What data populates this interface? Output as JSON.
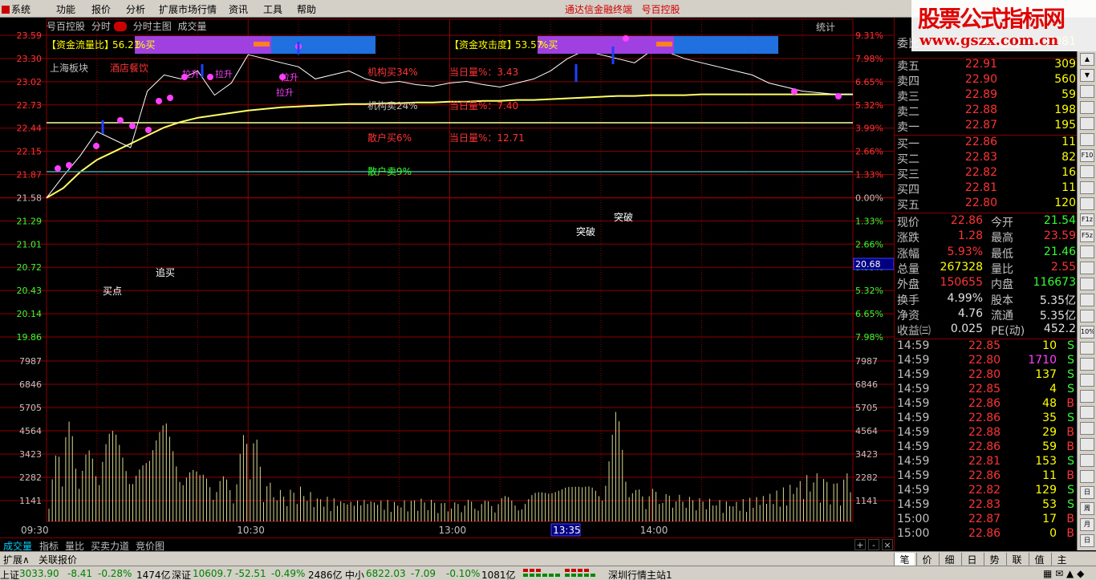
{
  "menu": {
    "items": [
      "系统",
      "功能",
      "报价",
      "分析",
      "扩展市场行情",
      "资讯",
      "工具",
      "帮助"
    ],
    "terminal_title": "通达信金融终端",
    "stock_title": "号百控股"
  },
  "watermark": {
    "line1": "股票公式指标网",
    "line2": "www.gszx.com.cn"
  },
  "chart_header": {
    "stock": "号百控股",
    "mode": "分时",
    "main_label": "分时主图",
    "volume_label": "成交量",
    "stats": "统计"
  },
  "indicator_boxes": [
    {
      "label": "【资金流量比】",
      "value": "56.21",
      "suffix": "%买"
    },
    {
      "label": "【资金攻击度】",
      "value": "53.57",
      "suffix": "%买"
    }
  ],
  "annotations": {
    "sector": "上海板块",
    "industry": "酒店餐饮",
    "inst_buy": "机构买34%",
    "inst_sell": "机构卖24%",
    "retail_buy": "散户买6%",
    "retail_sell": "散户卖9%",
    "today_vol1": "当日量%：3.43",
    "today_vol2": "当日量%：7.40",
    "today_vol3": "当日量%：12.71",
    "buy_point": "买点",
    "chase_buy": "追买",
    "breakout1": "突破",
    "breakout2": "突破",
    "pullup": "拉升"
  },
  "axes": {
    "price_labels": [
      "23.59",
      "23.30",
      "23.02",
      "22.73",
      "22.44",
      "22.15",
      "21.87",
      "21.58",
      "21.29",
      "21.01",
      "20.72",
      "20.43",
      "20.14",
      "19.86"
    ],
    "pct_labels": [
      "9.31%",
      "7.98%",
      "6.65%",
      "5.32%",
      "3.99%",
      "2.66%",
      "1.33%",
      "0.00%",
      "1.33%",
      "2.66%",
      "3.99%",
      "5.32%",
      "6.65%",
      "7.98%"
    ],
    "vol_labels": [
      "7987",
      "6846",
      "5705",
      "4564",
      "3423",
      "2282",
      "1141"
    ],
    "time_labels": [
      "09:30",
      "10:30",
      "13:00",
      "13:35",
      "14:00"
    ],
    "cursor_price": "20.68",
    "ref_price": 21.58,
    "max_price": 23.59,
    "min_price": 19.86,
    "max_vol": 7987,
    "colors": {
      "up": "#ff3333",
      "down": "#33ff33",
      "grid": "#8b0000",
      "price_line": "#ffffff",
      "avg_line": "#ffff66"
    }
  },
  "chart_data": {
    "type": "line",
    "x_time": [
      "09:30",
      "09:35",
      "09:40",
      "09:45",
      "09:50",
      "09:55",
      "10:00",
      "10:05",
      "10:10",
      "10:15",
      "10:20",
      "10:25",
      "10:30",
      "10:35",
      "10:40",
      "10:45",
      "10:50",
      "10:55",
      "11:00",
      "11:05",
      "11:10",
      "11:15",
      "11:20",
      "11:25",
      "13:00",
      "13:05",
      "13:10",
      "13:15",
      "13:20",
      "13:25",
      "13:30",
      "13:35",
      "13:40",
      "13:45",
      "13:50",
      "13:55",
      "14:00",
      "14:05",
      "14:10",
      "14:15",
      "14:20",
      "14:25",
      "14:30",
      "14:35",
      "14:40",
      "14:45",
      "14:50",
      "14:55",
      "15:00"
    ],
    "series": [
      {
        "values": [
          21.58,
          21.85,
          22.1,
          22.4,
          22.3,
          22.2,
          22.9,
          23.1,
          23.05,
          23.15,
          22.85,
          23.0,
          23.35,
          23.3,
          23.25,
          23.2,
          23.05,
          23.1,
          23.15,
          23.05,
          23.0,
          23.02,
          22.98,
          22.96,
          23.0,
          23.02,
          22.98,
          22.95,
          23.0,
          23.05,
          23.15,
          23.3,
          23.4,
          23.35,
          23.3,
          23.25,
          23.4,
          23.38,
          23.3,
          23.25,
          23.2,
          23.15,
          23.1,
          23.0,
          22.95,
          22.9,
          22.88,
          22.86,
          22.86
        ]
      },
      {
        "values": [
          21.58,
          21.7,
          21.9,
          22.05,
          22.15,
          22.25,
          22.35,
          22.45,
          22.52,
          22.57,
          22.6,
          22.63,
          22.66,
          22.68,
          22.7,
          22.71,
          22.72,
          22.73,
          22.74,
          22.74,
          22.75,
          22.75,
          22.76,
          22.76,
          22.77,
          22.77,
          22.78,
          22.78,
          22.79,
          22.79,
          22.8,
          22.81,
          22.82,
          22.83,
          22.84,
          22.84,
          22.85,
          22.85,
          22.85,
          22.86,
          22.86,
          22.86,
          22.86,
          22.86,
          22.86,
          22.86,
          22.86,
          22.86,
          22.86
        ]
      }
    ],
    "volume": [
      1800,
      5500,
      3200,
      4200,
      4600,
      4500,
      3900,
      6800,
      4400,
      2300,
      2600,
      1900,
      5700,
      2100,
      1500,
      1800,
      1300,
      1200,
      1100,
      1200,
      1100,
      1000,
      1200,
      1100,
      900,
      1100,
      1000,
      1300,
      1200,
      1500,
      1400,
      1800,
      1700,
      2200,
      5700,
      1600,
      1700,
      1400,
      1300,
      1200,
      1100,
      1000,
      1200,
      1400,
      1700,
      2200,
      2500,
      2000,
      2600
    ]
  },
  "quote_panel": {
    "weibi": "委比",
    "weibi_val": "63.29%",
    "weicha": "委差",
    "weicha_val": "1081",
    "sells": [
      {
        "label": "卖五",
        "price": "22.91",
        "vol": "309"
      },
      {
        "label": "卖四",
        "price": "22.90",
        "vol": "560"
      },
      {
        "label": "卖三",
        "price": "22.89",
        "vol": "59"
      },
      {
        "label": "卖二",
        "price": "22.88",
        "vol": "198"
      },
      {
        "label": "卖一",
        "price": "22.87",
        "vol": "195"
      }
    ],
    "buys": [
      {
        "label": "买一",
        "price": "22.86",
        "vol": "11"
      },
      {
        "label": "买二",
        "price": "22.83",
        "vol": "82"
      },
      {
        "label": "买三",
        "price": "22.82",
        "vol": "16"
      },
      {
        "label": "买四",
        "price": "22.81",
        "vol": "11"
      },
      {
        "label": "买五",
        "price": "22.80",
        "vol": "120"
      }
    ],
    "stats": [
      {
        "l1": "现价",
        "v1": "22.86",
        "c1": "#ff3333",
        "l2": "今开",
        "v2": "21.54",
        "c2": "#33ff33"
      },
      {
        "l1": "涨跌",
        "v1": "1.28",
        "c1": "#ff3333",
        "l2": "最高",
        "v2": "23.59",
        "c2": "#ff3333"
      },
      {
        "l1": "涨幅",
        "v1": "5.93%",
        "c1": "#ff3333",
        "l2": "最低",
        "v2": "21.46",
        "c2": "#33ff33"
      },
      {
        "l1": "总量",
        "v1": "267328",
        "c1": "#ffff00",
        "l2": "量比",
        "v2": "2.55",
        "c2": "#ff3333"
      },
      {
        "l1": "外盘",
        "v1": "150655",
        "c1": "#ff3333",
        "l2": "内盘",
        "v2": "116673",
        "c2": "#33ff33"
      },
      {
        "l1": "换手",
        "v1": "4.99%",
        "c1": "#e0e0e0",
        "l2": "股本",
        "v2": "5.35亿",
        "c2": "#e0e0e0"
      },
      {
        "l1": "净资",
        "v1": "4.76",
        "c1": "#e0e0e0",
        "l2": "流通",
        "v2": "5.35亿",
        "c2": "#e0e0e0"
      },
      {
        "l1": "收益㈢",
        "v1": "0.025",
        "c1": "#e0e0e0",
        "l2": "PE(动)",
        "v2": "452.2",
        "c2": "#e0e0e0"
      }
    ],
    "ticks": [
      {
        "t": "14:59",
        "p": "22.85",
        "v": "10",
        "d": "S"
      },
      {
        "t": "14:59",
        "p": "22.80",
        "v": "1710",
        "d": "S"
      },
      {
        "t": "14:59",
        "p": "22.80",
        "v": "137",
        "d": "S"
      },
      {
        "t": "14:59",
        "p": "22.85",
        "v": "4",
        "d": "S"
      },
      {
        "t": "14:59",
        "p": "22.86",
        "v": "48",
        "d": "B"
      },
      {
        "t": "14:59",
        "p": "22.86",
        "v": "35",
        "d": "S"
      },
      {
        "t": "14:59",
        "p": "22.88",
        "v": "29",
        "d": "B"
      },
      {
        "t": "14:59",
        "p": "22.86",
        "v": "59",
        "d": "B"
      },
      {
        "t": "14:59",
        "p": "22.81",
        "v": "153",
        "d": "S"
      },
      {
        "t": "14:59",
        "p": "22.86",
        "v": "11",
        "d": "B"
      },
      {
        "t": "14:59",
        "p": "22.82",
        "v": "129",
        "d": "S"
      },
      {
        "t": "14:59",
        "p": "22.83",
        "v": "53",
        "d": "S"
      },
      {
        "t": "15:00",
        "p": "22.87",
        "v": "17",
        "d": "B"
      },
      {
        "t": "15:00",
        "p": "22.86",
        "v": "0",
        "d": "B"
      }
    ]
  },
  "right_tools": [
    "▲",
    "▼",
    "",
    "",
    "",
    "",
    "F10",
    "",
    "",
    "",
    "F1z",
    "F5z",
    "",
    "",
    "",
    "",
    "",
    "10%",
    "",
    "",
    "",
    "",
    "",
    "",
    "",
    "",
    "",
    "日",
    "周",
    "月",
    "日"
  ],
  "bottom_tabs": [
    "成交量",
    "指标",
    "量比",
    "买卖力道",
    "竞价图"
  ],
  "zoom": {
    "plus": "+",
    "minus": "-",
    "close": "×"
  },
  "expand_tabs": [
    "扩展∧",
    "关联报价"
  ],
  "panel_tabs": [
    "笔",
    "价",
    "细",
    "日",
    "势",
    "联",
    "值",
    "主"
  ],
  "statusbar": {
    "sh_label": "上证",
    "sh_val": "3033.90",
    "sh_chg": "-8.41",
    "sh_pct": "-0.28%",
    "sh_amt": "1474亿",
    "sz_label": "深证",
    "sz_val": "10609.7",
    "sz_chg": "-52.51",
    "sz_pct": "-0.49%",
    "sz_amt": "2486亿",
    "zx_label": "中小",
    "zx_val": "6822.03",
    "zx_chg": "-7.09",
    "zx_pct": "-0.10%",
    "zx_amt": "1081亿",
    "station": "深圳行情主站1"
  }
}
